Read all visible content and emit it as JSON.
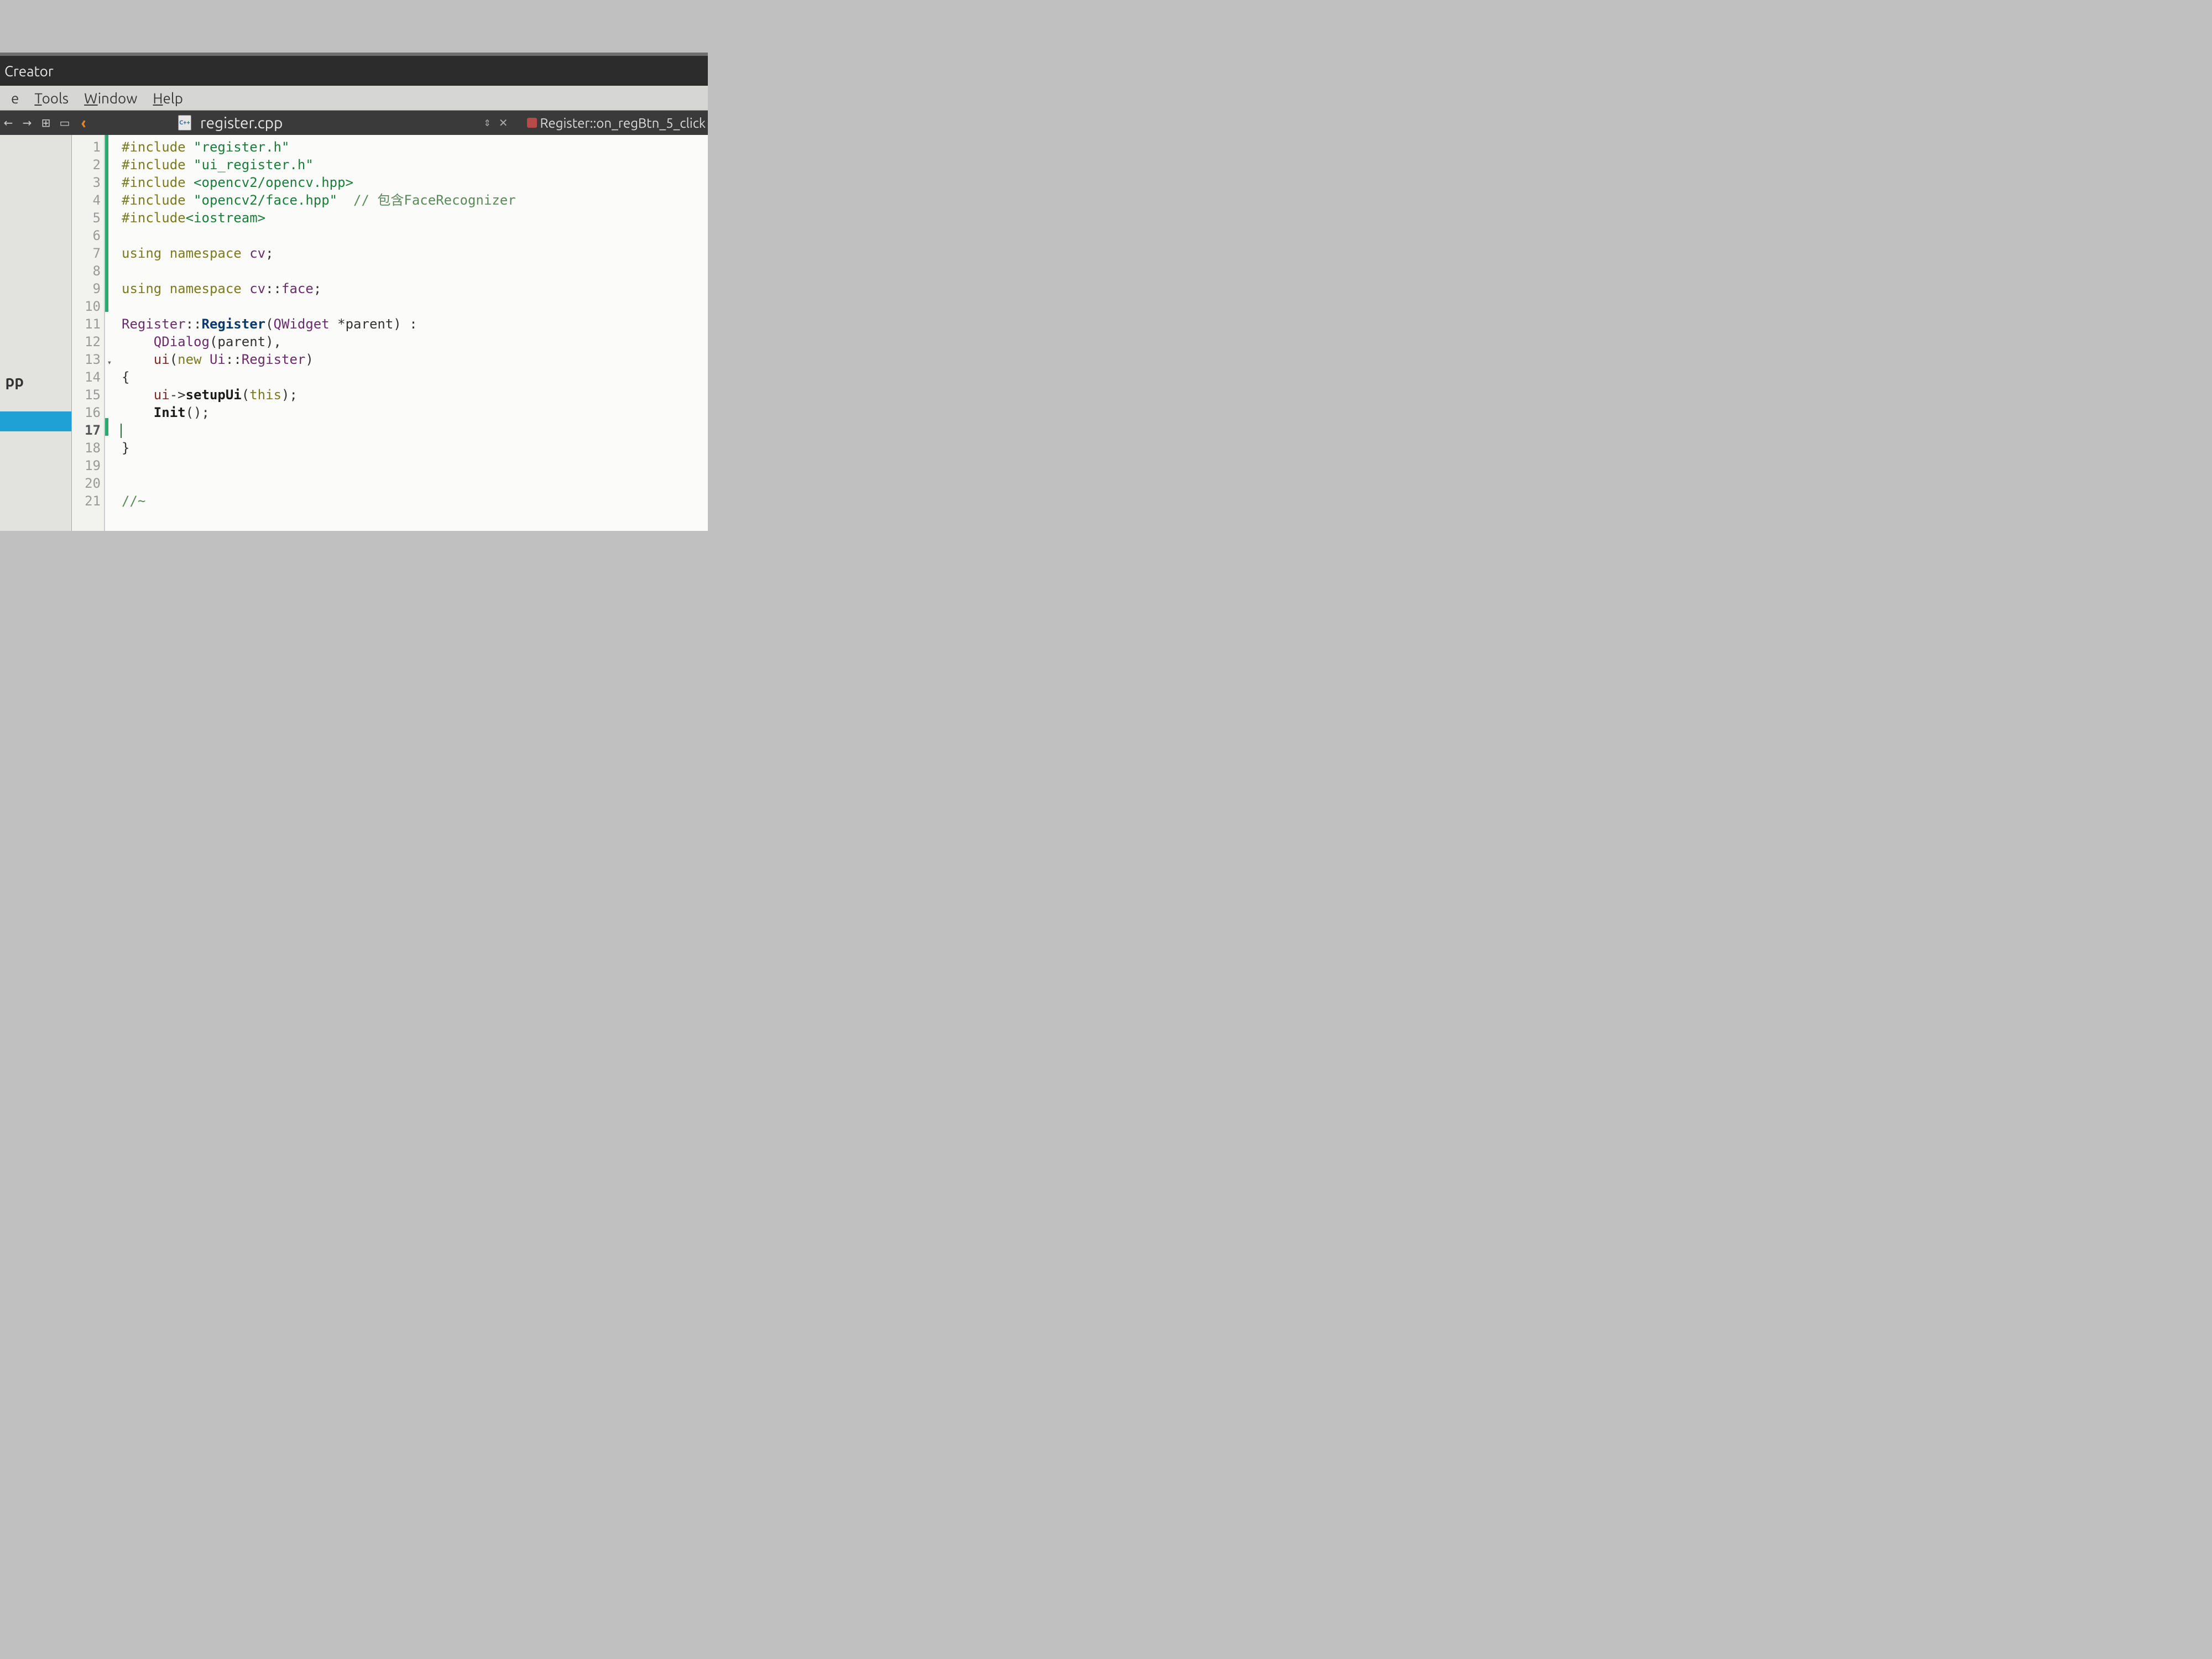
{
  "titlebar": {
    "text": "Creator"
  },
  "menu": {
    "items": [
      {
        "label": "e",
        "underline": false
      },
      {
        "label": "Tools",
        "underline": true
      },
      {
        "label": "Window",
        "underline": true
      },
      {
        "label": "Help",
        "underline": true
      }
    ]
  },
  "docbar": {
    "back_icon": "←",
    "fwd_icon": "→",
    "split_icon": "⊞",
    "expand_icon": "▭",
    "chevron": "‹",
    "file_badge": "C++",
    "filename": "register.cpp",
    "updown": "⇕",
    "close": "✕",
    "member_label": "Register::on_regBtn_5_click"
  },
  "sidebar": {
    "label_fragment": "pp"
  },
  "code": {
    "lines": [
      {
        "n": 1,
        "html": "<span class='kw'>#include</span> <span class='str'>\"register.h\"</span>"
      },
      {
        "n": 2,
        "html": "<span class='kw'>#include</span> <span class='str'>\"ui_register.h\"</span>"
      },
      {
        "n": 3,
        "html": "<span class='kw'>#include</span> <span class='str'>&lt;opencv2/opencv.hpp&gt;</span>"
      },
      {
        "n": 4,
        "html": "<span class='kw'>#include</span> <span class='str'>\"opencv2/face.hpp\"</span>  <span class='cmnt'>// 包含FaceRecognizer</span>"
      },
      {
        "n": 5,
        "html": "<span class='kw'>#include</span><span class='str'>&lt;iostream&gt;</span>"
      },
      {
        "n": 6,
        "html": ""
      },
      {
        "n": 7,
        "html": "<span class='kw'>using</span> <span class='kw'>namespace</span> <span class='type'>cv</span>;"
      },
      {
        "n": 8,
        "html": ""
      },
      {
        "n": 9,
        "html": "<span class='kw'>using</span> <span class='kw'>namespace</span> <span class='type'>cv</span>::<span class='type'>face</span>;"
      },
      {
        "n": 10,
        "html": ""
      },
      {
        "n": 11,
        "html": "<span class='type'>Register</span>::<span class='funcdef'>Register</span>(<span class='type'>QWidget</span> *parent) :"
      },
      {
        "n": 12,
        "html": "    <span class='type'>QDialog</span>(parent),"
      },
      {
        "n": 13,
        "html": "    <span class='ident'>ui</span>(<span class='kw'>new</span> <span class='type'>Ui</span>::<span class='type'>Register</span>)",
        "fold": true
      },
      {
        "n": 14,
        "html": "{"
      },
      {
        "n": 15,
        "html": "    <span class='ident'>ui</span>-&gt;<span class='func'>setupUi</span>(<span class='kw'>this</span>);"
      },
      {
        "n": 16,
        "html": "    <span class='func'>Init</span>();"
      },
      {
        "n": 17,
        "html": "<span class='cursor'></span>",
        "current": true
      },
      {
        "n": 18,
        "html": "}"
      },
      {
        "n": 19,
        "html": ""
      },
      {
        "n": 20,
        "html": ""
      },
      {
        "n": 21,
        "html": "<span class='cmnt'>//~</span>"
      }
    ],
    "change_marks": [
      1,
      2,
      3,
      4,
      5,
      6,
      7,
      8,
      9,
      10,
      17
    ]
  }
}
